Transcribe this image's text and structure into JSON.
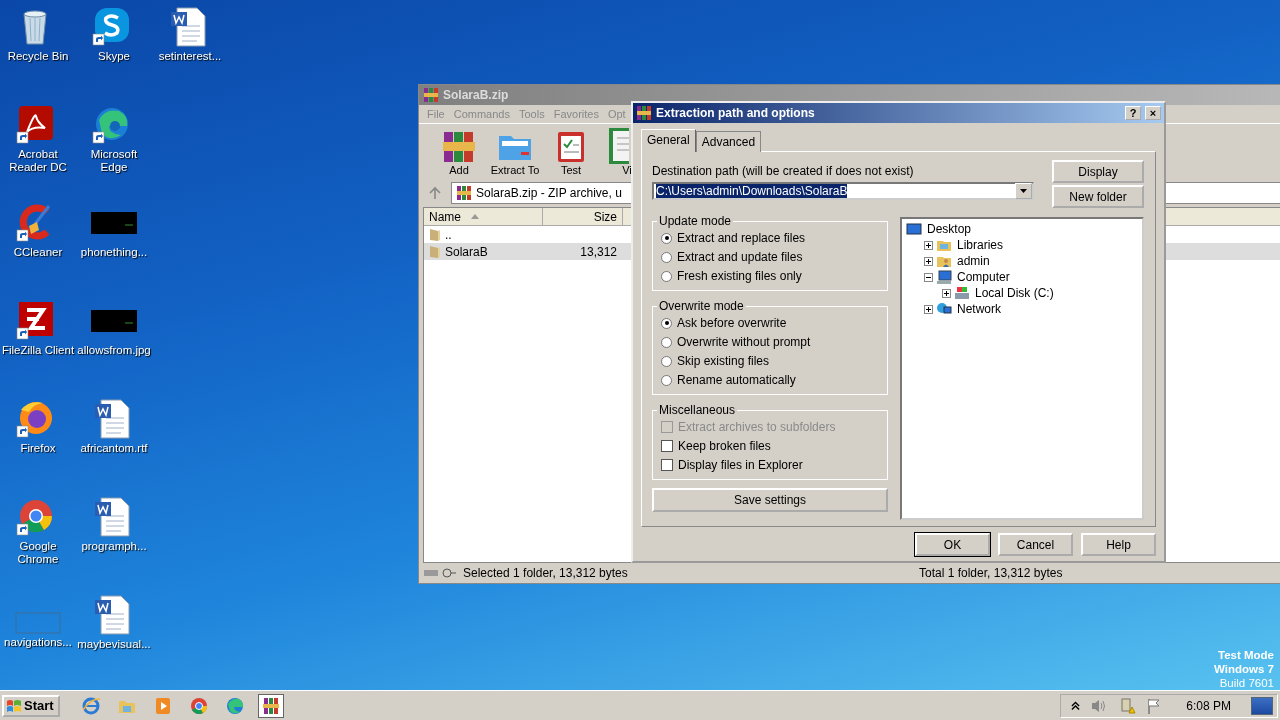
{
  "desktop": {
    "icons": [
      {
        "label": "Recycle Bin",
        "kind": "bin",
        "shortcut": false
      },
      {
        "label": "Acrobat Reader DC",
        "kind": "acrobat",
        "shortcut": true
      },
      {
        "label": "CCleaner",
        "kind": "ccleaner",
        "shortcut": true
      },
      {
        "label": "FileZilla Client",
        "kind": "filezilla",
        "shortcut": true
      },
      {
        "label": "Firefox",
        "kind": "firefox",
        "shortcut": true
      },
      {
        "label": "Google Chrome",
        "kind": "chrome",
        "shortcut": true
      },
      {
        "label": "navigations...",
        "kind": "blank",
        "shortcut": false
      },
      {
        "label": "Skype",
        "kind": "skype",
        "shortcut": true
      },
      {
        "label": "Microsoft Edge",
        "kind": "edge",
        "shortcut": true
      },
      {
        "label": "phonething...",
        "kind": "dark-image",
        "shortcut": false
      },
      {
        "label": "allowsfrom.jpg",
        "kind": "dark-image",
        "shortcut": false
      },
      {
        "label": "africantom.rtf",
        "kind": "document",
        "shortcut": false
      },
      {
        "label": "programph...",
        "kind": "document",
        "shortcut": false
      },
      {
        "label": "maybevisual...",
        "kind": "document",
        "shortcut": false
      },
      {
        "label": "setinterest...",
        "kind": "document",
        "shortcut": false
      }
    ]
  },
  "os_notice": [
    "Test Mode",
    "Windows 7",
    "Build 7601"
  ],
  "winrar": {
    "title": "SolaraB.zip",
    "menu": [
      "File",
      "Commands",
      "Tools",
      "Favorites",
      "Opt"
    ],
    "toolbar": [
      {
        "label": "Add",
        "kind": "add"
      },
      {
        "label": "Extract To",
        "kind": "extract"
      },
      {
        "label": "Test",
        "kind": "test"
      },
      {
        "label": "Vi",
        "kind": "view"
      }
    ],
    "address": "SolaraB.zip - ZIP archive, u",
    "columns": [
      "Name",
      "Size"
    ],
    "rows": [
      {
        "name": "..",
        "selected": false
      },
      {
        "name": "SolaraB",
        "size": "13,312",
        "selected": true
      }
    ],
    "status_left": "Selected 1 folder, 13,312 bytes",
    "status_right": "Total 1 folder, 13,312 bytes"
  },
  "dialog": {
    "title": "Extraction path and options",
    "title_buttons": [
      "?",
      "×"
    ],
    "tabs": [
      {
        "label": "General",
        "selected": true
      },
      {
        "label": "Advanced",
        "selected": false
      }
    ],
    "destination_label": "Destination path (will be created if does not exist)",
    "destination_value": "C:\\Users\\admin\\Downloads\\SolaraB",
    "side_buttons": [
      "Display",
      "New folder"
    ],
    "groups": [
      {
        "title": "Update mode",
        "kind": "radio",
        "options": [
          {
            "label": "Extract and replace files",
            "selected": true
          },
          {
            "label": "Extract and update files",
            "selected": false
          },
          {
            "label": "Fresh existing files only",
            "selected": false
          }
        ]
      },
      {
        "title": "Overwrite mode",
        "kind": "radio",
        "options": [
          {
            "label": "Ask before overwrite",
            "selected": true
          },
          {
            "label": "Overwrite without prompt",
            "selected": false
          },
          {
            "label": "Skip existing files",
            "selected": false
          },
          {
            "label": "Rename automatically",
            "selected": false
          }
        ]
      },
      {
        "title": "Miscellaneous",
        "kind": "checkbox",
        "options": [
          {
            "label": "Extract archives to subfolders",
            "checked": false,
            "disabled": true
          },
          {
            "label": "Keep broken files",
            "checked": false,
            "disabled": false
          },
          {
            "label": "Display files in Explorer",
            "checked": false,
            "disabled": false
          }
        ]
      }
    ],
    "save_button": "Save settings",
    "tree": [
      {
        "label": "Desktop",
        "kind": "desktop",
        "children": [
          {
            "label": "Libraries",
            "kind": "libraries",
            "expanded": false
          },
          {
            "label": "admin",
            "kind": "user",
            "expanded": false
          },
          {
            "label": "Computer",
            "kind": "computer",
            "expanded": true,
            "children": [
              {
                "label": "Local Disk (C:)",
                "kind": "disk",
                "expanded": false
              }
            ]
          },
          {
            "label": "Network",
            "kind": "network",
            "expanded": false
          }
        ]
      }
    ],
    "buttons": [
      {
        "label": "OK",
        "default": true
      },
      {
        "label": "Cancel",
        "default": false
      },
      {
        "label": "Help",
        "default": false
      }
    ]
  },
  "taskbar": {
    "start": "Start",
    "apps": [
      {
        "kind": "ie",
        "active": false
      },
      {
        "kind": "folder",
        "active": false
      },
      {
        "kind": "media",
        "active": false
      },
      {
        "kind": "chrome",
        "active": false
      },
      {
        "kind": "edge",
        "active": false
      },
      {
        "kind": "winrar",
        "active": true
      }
    ],
    "tray": [
      {
        "kind": "chevron"
      },
      {
        "kind": "speaker"
      },
      {
        "kind": "network-warning"
      },
      {
        "kind": "flag"
      }
    ],
    "clock": "6:08 PM"
  }
}
